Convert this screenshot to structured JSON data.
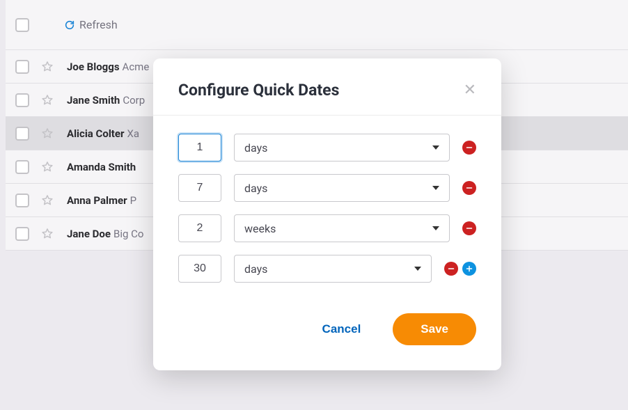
{
  "toolbar": {
    "refresh_label": "Refresh"
  },
  "rows": [
    {
      "name": "Joe Bloggs",
      "sub": "Acme",
      "highlighted": false
    },
    {
      "name": "Jane Smith",
      "sub": "Corp",
      "highlighted": false
    },
    {
      "name": "Alicia Colter",
      "sub": "Xa",
      "highlighted": true
    },
    {
      "name": "Amanda Smith",
      "sub": "",
      "highlighted": false
    },
    {
      "name": "Anna Palmer",
      "sub": "P",
      "highlighted": false
    },
    {
      "name": "Jane Doe",
      "sub": "Big Co",
      "highlighted": false
    }
  ],
  "modal": {
    "title": "Configure Quick Dates",
    "cancel_label": "Cancel",
    "save_label": "Save",
    "rows": [
      {
        "value": "1",
        "unit": "days",
        "focused": true,
        "show_add": false
      },
      {
        "value": "7",
        "unit": "days",
        "focused": false,
        "show_add": false
      },
      {
        "value": "2",
        "unit": "weeks",
        "focused": false,
        "show_add": false
      },
      {
        "value": "30",
        "unit": "days",
        "focused": false,
        "show_add": true
      }
    ]
  }
}
